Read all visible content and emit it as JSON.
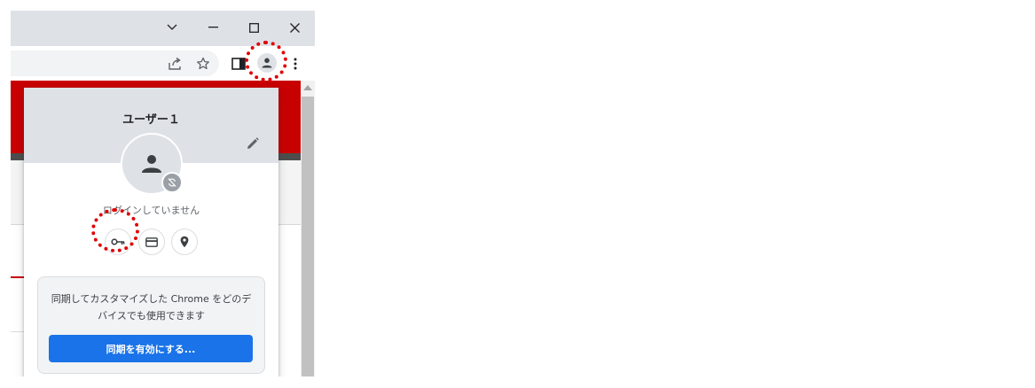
{
  "window": {
    "controls": [
      {
        "icon": "chevron-down-icon",
        "glyph": "∨"
      },
      {
        "icon": "minimize-icon",
        "glyph": "—"
      },
      {
        "icon": "maximize-icon",
        "glyph": "☐"
      },
      {
        "icon": "close-icon",
        "glyph": "✕"
      }
    ]
  },
  "toolbar": {
    "icons": [
      "share-icon",
      "star-icon",
      "side-panel-icon",
      "profile-icon",
      "menu-icon"
    ]
  },
  "profile_menu": {
    "name": "ユーザー１",
    "status": "ログインしていません",
    "quick_icons": [
      "key-icon",
      "card-icon",
      "location-icon"
    ],
    "sync_text": "同期してカスタマイズした Chrome をどのデバイスでも使用できます",
    "sync_button": "同期を有効にする..."
  },
  "colors": {
    "sync_button": "#1a73e8",
    "highlight": "#e00000",
    "page_accent": "#c80000"
  }
}
